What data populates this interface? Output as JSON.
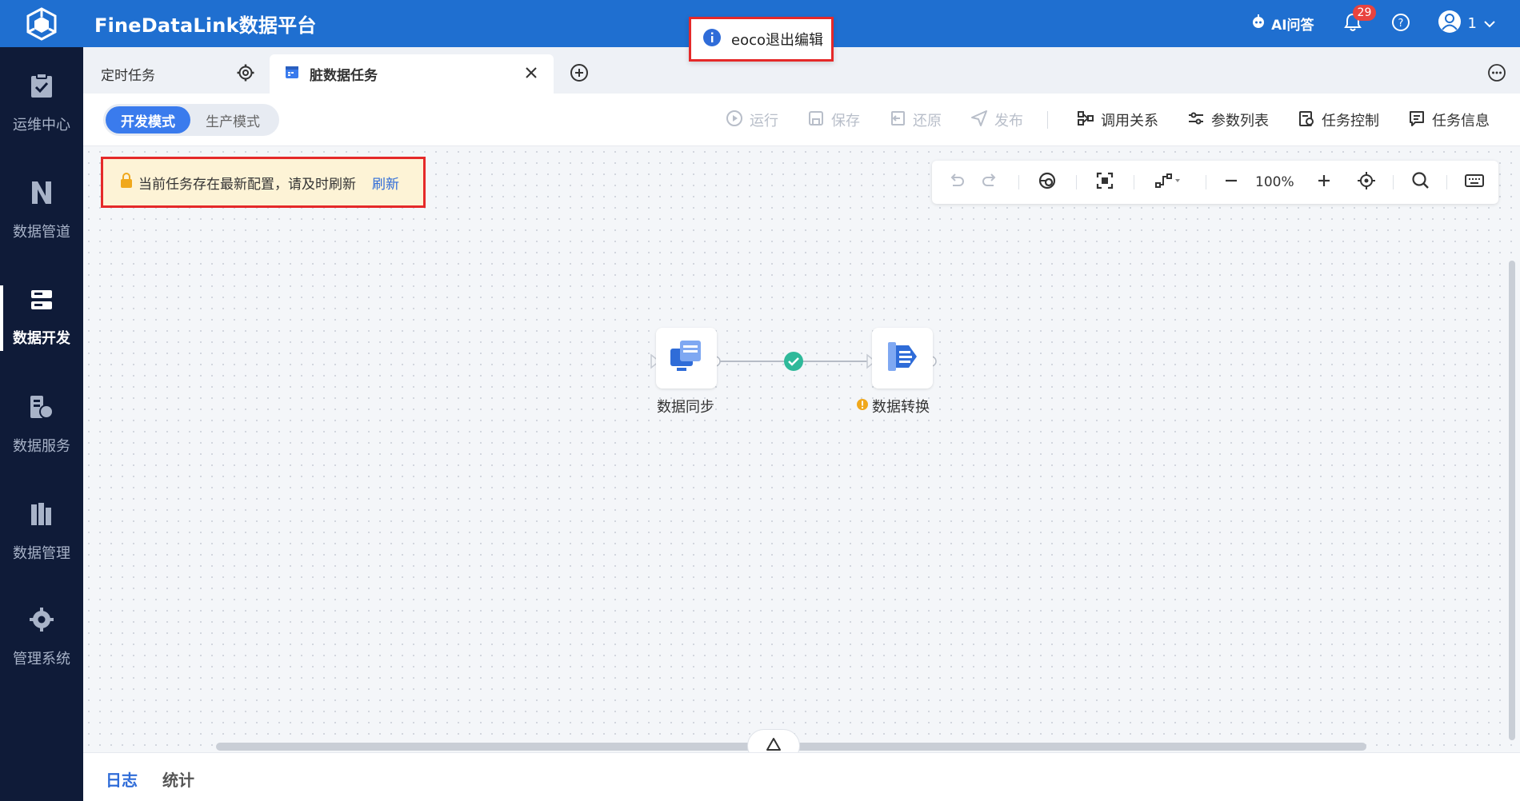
{
  "app": {
    "title": "FineDataLink数据平台"
  },
  "header": {
    "ai_label": "AI问答",
    "notification_count": "29",
    "user_name": "1"
  },
  "sidebar": {
    "items": [
      {
        "label": "运维中心"
      },
      {
        "label": "数据管道"
      },
      {
        "label": "数据开发"
      },
      {
        "label": "数据服务"
      },
      {
        "label": "数据管理"
      },
      {
        "label": "管理系统"
      }
    ],
    "active_index": 2
  },
  "tabs": [
    {
      "label": "定时任务"
    },
    {
      "label": "脏数据任务"
    }
  ],
  "toolbar": {
    "modes": [
      "开发模式",
      "生产模式"
    ],
    "active_mode": "开发模式",
    "actions": [
      {
        "label": "运行",
        "enabled": false
      },
      {
        "label": "保存",
        "enabled": false
      },
      {
        "label": "还原",
        "enabled": false
      },
      {
        "label": "发布",
        "enabled": false
      },
      {
        "label": "调用关系",
        "enabled": true
      },
      {
        "label": "参数列表",
        "enabled": true
      },
      {
        "label": "任务控制",
        "enabled": true
      },
      {
        "label": "任务信息",
        "enabled": true
      }
    ]
  },
  "notice": {
    "text": "当前任务存在最新配置，请及时刷新",
    "link": "刷新"
  },
  "canvas_tools": {
    "zoom": "100%"
  },
  "toast": {
    "text": "eoco退出编辑"
  },
  "nodes": [
    {
      "label": "数据同步"
    },
    {
      "label": "数据转换"
    }
  ],
  "bottom_tabs": [
    {
      "label": "日志"
    },
    {
      "label": "统计"
    }
  ],
  "colors": {
    "primary": "#1f6fd0",
    "accent": "#3a7bed",
    "sidebar_bg": "#0f1b38",
    "highlight_border": "#e52929",
    "notice_bg": "#fdf3d6",
    "success": "#2fb99a",
    "warning": "#f0a81c"
  }
}
